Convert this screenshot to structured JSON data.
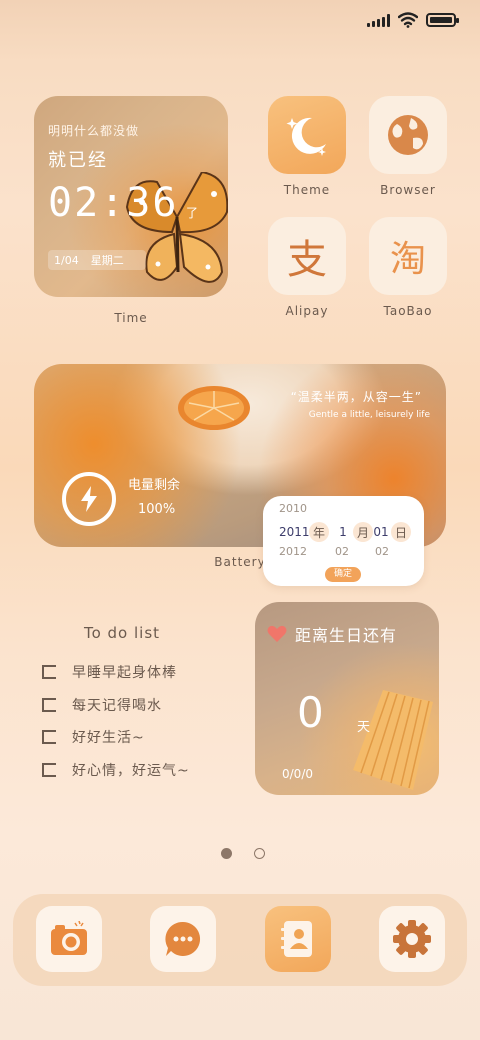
{
  "colors": {
    "accent": "#f2a75a",
    "text": "#6b5a4e",
    "icon_orange": "#e48c45"
  },
  "status_bar": {
    "icons": [
      "signal-icon",
      "wifi-icon",
      "battery-icon"
    ]
  },
  "time_widget": {
    "subtitle": "明明什么都没做",
    "headline": "就已经",
    "time": "02:36",
    "suffix": "了",
    "date": "1/04",
    "weekday": "星期二",
    "label": "Time"
  },
  "apps": [
    {
      "name": "Theme",
      "icon": "moon-icon"
    },
    {
      "name": "Browser",
      "icon": "globe-icon"
    },
    {
      "name": "Alipay",
      "icon": "alipay-icon",
      "glyph": "支"
    },
    {
      "name": "TaoBao",
      "icon": "taobao-icon",
      "glyph": "淘"
    }
  ],
  "battery_widget": {
    "title": "电量剩余",
    "percent": "100%",
    "quote": "“温柔半两，从容一生”",
    "quote_en": "Gentle a little, leisurely life",
    "label": "Battery"
  },
  "date_picker": {
    "rows": [
      {
        "year": "2010",
        "month": "",
        "day": ""
      },
      {
        "year": "2011",
        "month": "1",
        "day": "01"
      },
      {
        "year": "2012",
        "month": "02",
        "day": "02"
      }
    ],
    "year_unit": "年",
    "month_unit": "月",
    "day_unit": "日",
    "confirm": "确定"
  },
  "todo": {
    "title": "To do list",
    "items": [
      "早睡早起身体棒",
      "每天记得喝水",
      "好好生活~",
      "好心情，好运气~"
    ]
  },
  "birthday_widget": {
    "title": "距离生日还有",
    "days": "0",
    "unit": "天",
    "date": "0/0/0"
  },
  "pages": {
    "count": 2,
    "current": 1
  },
  "dock": [
    {
      "name": "camera",
      "icon": "camera-icon"
    },
    {
      "name": "messages",
      "icon": "chat-icon"
    },
    {
      "name": "contacts",
      "icon": "contacts-icon"
    },
    {
      "name": "settings",
      "icon": "gear-icon"
    }
  ]
}
